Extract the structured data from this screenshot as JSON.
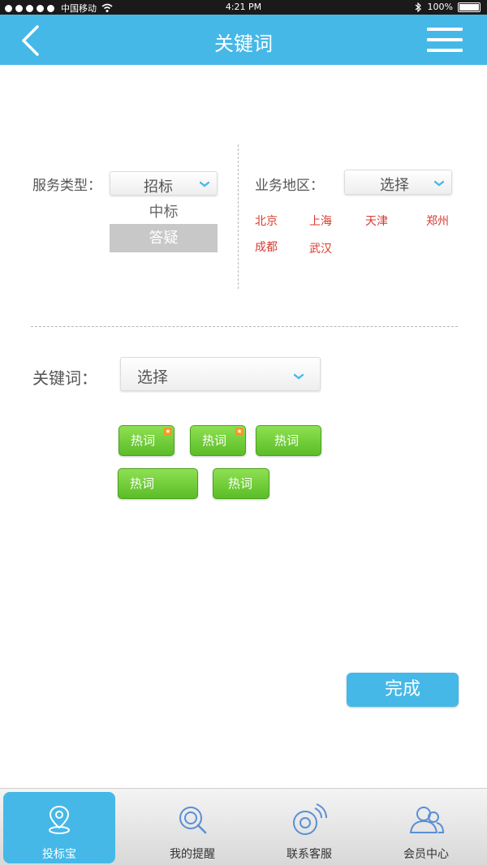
{
  "status_bar": {
    "carrier": "中国移动",
    "time": "4:21 PM",
    "battery": "100%"
  },
  "header": {
    "title": "关键词"
  },
  "service_type": {
    "label": "服务类型：",
    "selected": "招标",
    "options": [
      "中标",
      "答疑"
    ],
    "highlighted_option": "答疑"
  },
  "region": {
    "label": "业务地区：",
    "selected": "选择",
    "cities": [
      "北京",
      "上海",
      "天津",
      "郑州",
      "成都",
      "武汉"
    ]
  },
  "keyword": {
    "label": "关键词：",
    "selected": "选择",
    "hot_tags": [
      {
        "label": "热词",
        "starred": true
      },
      {
        "label": "热词",
        "starred": true
      },
      {
        "label": "热词",
        "starred": false
      },
      {
        "label": "热词",
        "starred": false
      },
      {
        "label": "热词",
        "starred": false
      }
    ]
  },
  "done_label": "完成",
  "tabbar": {
    "items": [
      {
        "label": "投标宝",
        "icon": "location-pin-icon",
        "active": true
      },
      {
        "label": "我的提醒",
        "icon": "search-reminder-icon",
        "active": false
      },
      {
        "label": "联系客服",
        "icon": "customer-service-icon",
        "active": false
      },
      {
        "label": "会员中心",
        "icon": "members-icon",
        "active": false
      }
    ]
  },
  "colors": {
    "primary": "#45b8e8",
    "city_text": "#d83a2e",
    "tag_green": "#6cc935",
    "highlight_gray": "#c8c8c8"
  }
}
